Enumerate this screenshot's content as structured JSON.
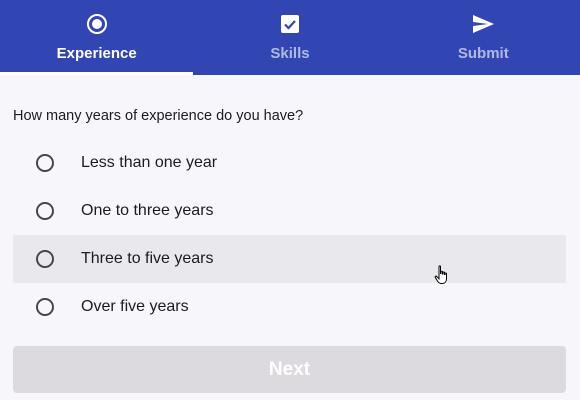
{
  "tabs": [
    {
      "label": "Experience",
      "icon": "radio-button-checked-icon",
      "active": true
    },
    {
      "label": "Skills",
      "icon": "checkbox-checked-icon",
      "active": false
    },
    {
      "label": "Submit",
      "icon": "send-icon",
      "active": false
    }
  ],
  "colors": {
    "primary": "#3145b3",
    "hover": "#e9e8ed",
    "disabled_button": "#dcdadf"
  },
  "form": {
    "question": "How many years of experience do you have?",
    "options": [
      {
        "label": "Less than one year"
      },
      {
        "label": "One to three years"
      },
      {
        "label": "Three to five years",
        "hovered": true
      },
      {
        "label": "Over five years"
      }
    ],
    "next_label": "Next"
  }
}
